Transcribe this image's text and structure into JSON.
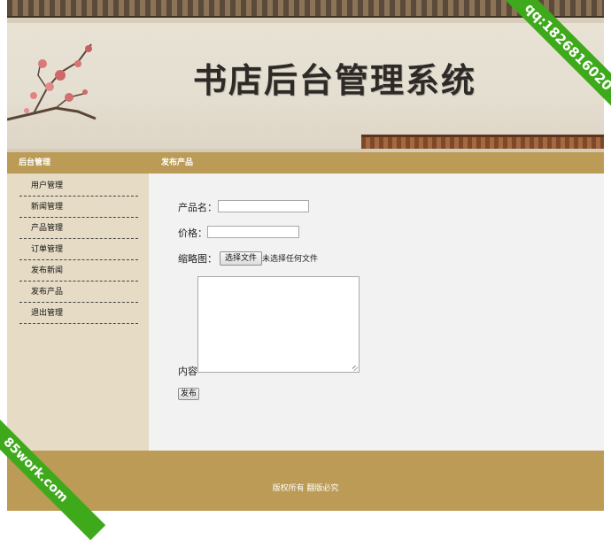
{
  "banner": {
    "title": "书店后台管理系统"
  },
  "sidebar": {
    "header": "后台管理",
    "items": [
      {
        "label": "用户管理"
      },
      {
        "label": "新闻管理"
      },
      {
        "label": "产品管理"
      },
      {
        "label": "订单管理"
      },
      {
        "label": "发布新闻"
      },
      {
        "label": "发布产品"
      },
      {
        "label": "退出管理"
      }
    ]
  },
  "main": {
    "header": "发布产品",
    "form": {
      "name_label": "产品名：",
      "name_value": "",
      "price_label": "价格：",
      "price_value": "",
      "thumb_label": "缩略图：",
      "file_button": "选择文件",
      "file_status": "未选择任何文件",
      "content_label": "内容",
      "content_value": "",
      "submit_label": "发布"
    }
  },
  "footer": {
    "copyright": "版权所有 翻版必究"
  },
  "watermarks": {
    "top_right": "qq:1826816020",
    "bottom_left": "85work.com"
  },
  "colors": {
    "accent": "#bb9b56",
    "sidebar_bg": "#e6dbc5",
    "ribbon": "#3fa91c"
  }
}
